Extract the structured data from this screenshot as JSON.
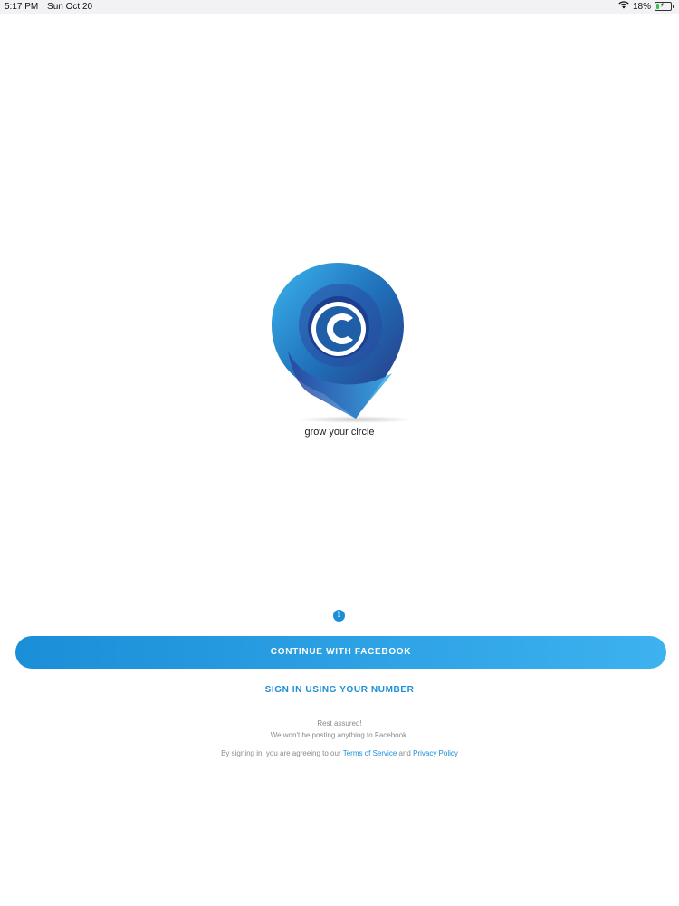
{
  "status_bar": {
    "time": "5:17 PM",
    "date": "Sun Oct 20",
    "battery_percent": "18%",
    "battery_level": 0.18,
    "charging": true
  },
  "logo": {
    "icon": "location-pin-c-logo",
    "tagline": "grow your circle",
    "colors": {
      "primary": "#1f5fa8",
      "secondary": "#3cb4ee",
      "dark": "#2b2f7d"
    }
  },
  "info": {
    "icon": "info-icon",
    "glyph": "i"
  },
  "buttons": {
    "facebook": "CONTINUE WITH FACEBOOK",
    "phone": "SIGN IN USING YOUR NUMBER"
  },
  "note": {
    "line1": "Rest assured!",
    "line2": "We won't be posting anything to Facebook."
  },
  "terms": {
    "prefix": "By signing in, you are agreeing to our",
    "tos": "Terms of Service",
    "and": "and",
    "privacy": "Privacy Policy"
  },
  "colors": {
    "accent": "#1a8ed8",
    "accent_light": "#3db2ef",
    "muted_text": "#8a8a8a"
  }
}
